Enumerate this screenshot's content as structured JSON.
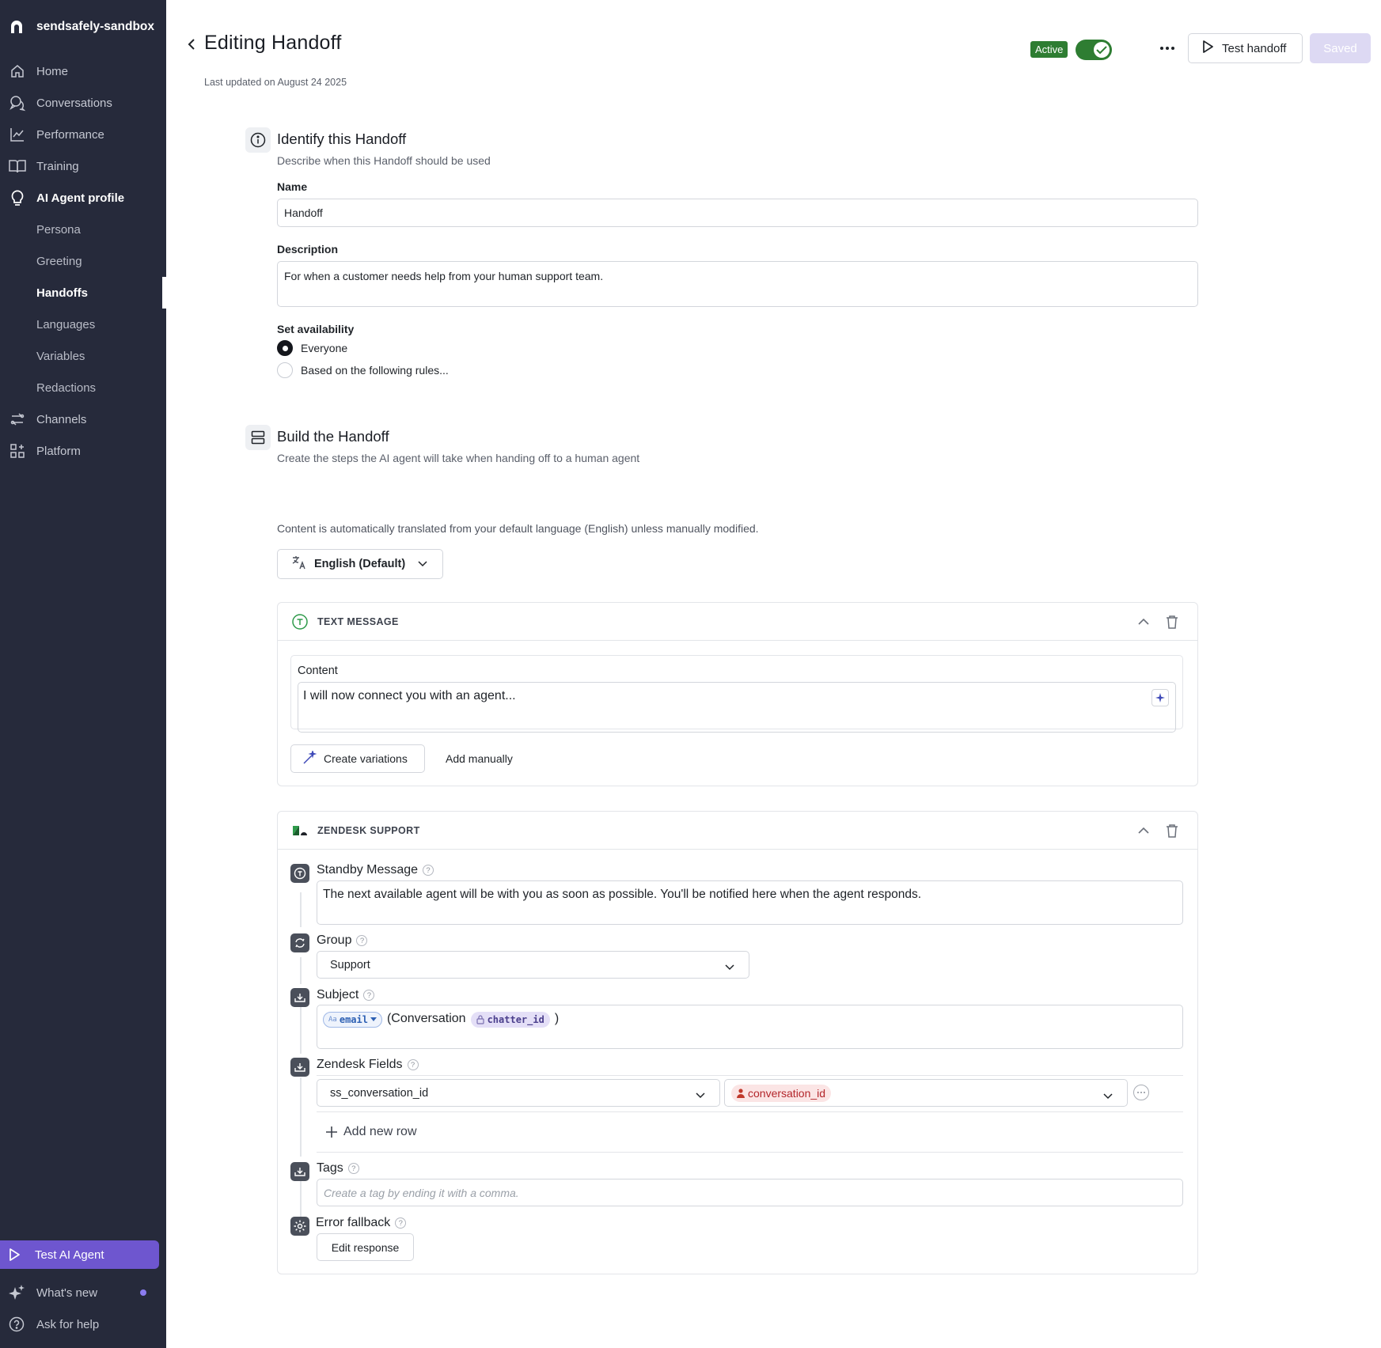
{
  "sidebar": {
    "org_name": "sendsafely-sandbox",
    "items": [
      {
        "label": "Home",
        "icon": "home-icon"
      },
      {
        "label": "Conversations",
        "icon": "conversations-icon"
      },
      {
        "label": "Performance",
        "icon": "performance-chart-icon"
      },
      {
        "label": "Training",
        "icon": "book-icon"
      },
      {
        "label": "AI Agent profile",
        "icon": "lightbulb-icon"
      }
    ],
    "sub_items": [
      "Persona",
      "Greeting",
      "Handoffs",
      "Languages",
      "Variables",
      "Redactions"
    ],
    "items2": [
      {
        "label": "Channels",
        "icon": "channels-icon"
      },
      {
        "label": "Platform",
        "icon": "platform-grid-icon"
      }
    ],
    "test_agent": "Test AI Agent",
    "whats_new": "What's new",
    "ask_help": "Ask for help"
  },
  "header": {
    "title": "Editing Handoff",
    "last_updated": "Last updated on August 24 2025",
    "status": "Active",
    "test_button": "Test handoff",
    "saved_button": "Saved"
  },
  "identify": {
    "title": "Identify this Handoff",
    "subtitle": "Describe when this Handoff should be used",
    "name_label": "Name",
    "name_value": "Handoff",
    "description_label": "Description",
    "description_value": "For when a customer needs help from your human support team.",
    "availability_label": "Set availability",
    "option_everyone": "Everyone",
    "option_rules": "Based on the following rules..."
  },
  "build": {
    "title": "Build the Handoff",
    "subtitle": "Create the steps the AI agent will take when handing off to a human agent",
    "translation_note": "Content is automatically translated from your default language (English) unless manually modified.",
    "language": "English (Default)"
  },
  "text_message": {
    "title": "TEXT MESSAGE",
    "content_label": "Content",
    "content_value": "I will now connect you with an agent...",
    "create_variations": "Create variations",
    "add_manually": "Add manually"
  },
  "zendesk": {
    "title": "ZENDESK SUPPORT",
    "standby_label": "Standby Message",
    "standby_value": "The next available agent will be with you as soon as possible. You'll be notified here when the agent responds.",
    "group_label": "Group",
    "group_value": "Support",
    "subject_label": "Subject",
    "subject_pill_prefix": "Aa",
    "subject_pill_email": "email",
    "subject_text": "(Conversation",
    "subject_pill_chatter": "chatter_id",
    "subject_close": ")",
    "fields_label": "Zendesk Fields",
    "field_name": "ss_conversation_id",
    "field_value": "conversation_id",
    "add_row": "Add new row",
    "tags_label": "Tags",
    "tags_placeholder": "Create a tag by ending it with a comma.",
    "error_label": "Error fallback",
    "edit_response": "Edit response"
  },
  "colors": {
    "sidebar_bg": "#262a3b",
    "accent_purple": "#6e56cf",
    "active_green": "#2e7d32",
    "saved_disabled": "#ddd9f3"
  }
}
